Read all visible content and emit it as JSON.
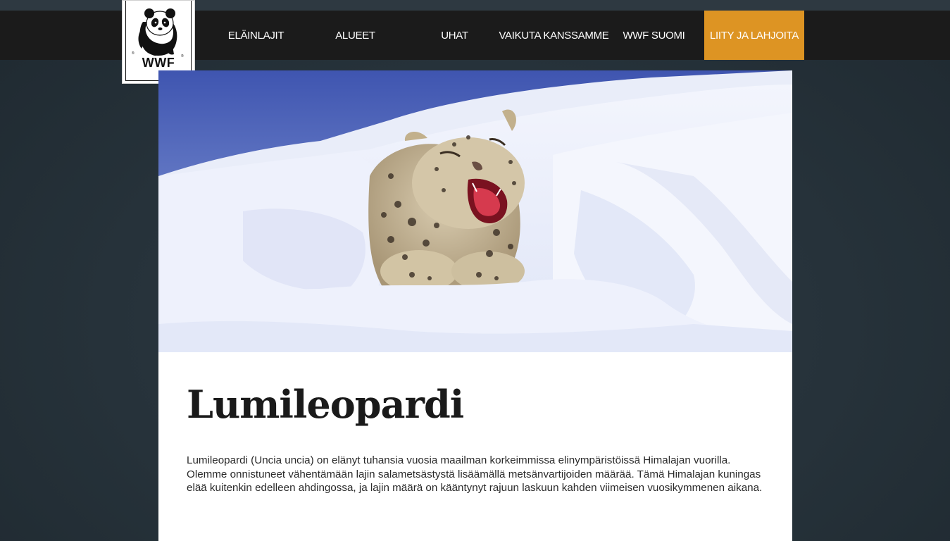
{
  "nav": {
    "items": [
      "ELÄINLAJIT",
      "ALUEET",
      "UHAT",
      "VAIKUTA KANSSAMME",
      "WWF SUOMI"
    ],
    "cta": "LIITY JA LAHJOITA",
    "cta_color": "#dd9423"
  },
  "logo": {
    "text": "WWF",
    "icon": "panda-logo-icon"
  },
  "hero": {
    "image": "snow-leopard-yawning-in-snow"
  },
  "article": {
    "title": "Lumileopardi",
    "body": "Lumileopardi (Uncia uncia) on elänyt tuhansia vuosia maailman korkeimmissa elinympäristöissä Himalajan vuorilla. Olemme onnistuneet vähentämään lajin salametsästystä lisäämällä metsänvartijoiden määrää. Tämä Himalajan kuningas elää kuitenkin edelleen ahdingossa, ja lajin määrä on kääntynyt rajuun laskuun kahden viimeisen vuosikymmenen aikana."
  }
}
